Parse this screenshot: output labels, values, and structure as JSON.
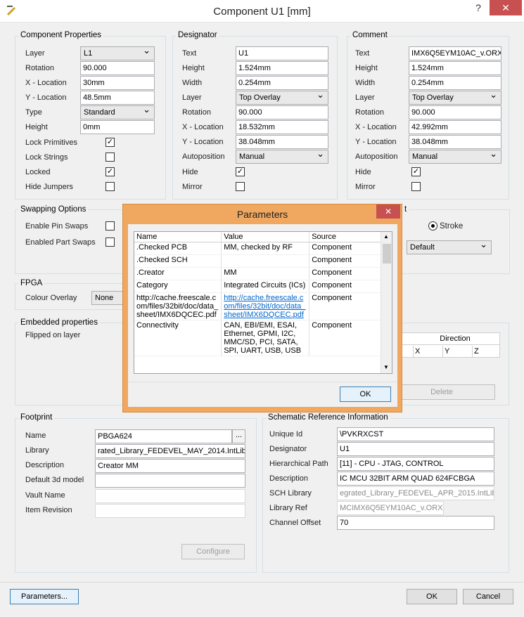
{
  "window": {
    "title": "Component U1 [mm]",
    "help": "?",
    "close": "✕"
  },
  "component_properties": {
    "title": "Component Properties",
    "layer_label": "Layer",
    "layer_value": "L1",
    "rotation_label": "Rotation",
    "rotation_value": "90.000",
    "x_label": "X - Location",
    "x_value": "30mm",
    "y_label": "Y - Location",
    "y_value": "48.5mm",
    "type_label": "Type",
    "type_value": "Standard",
    "height_label": "Height",
    "height_value": "0mm",
    "lock_primitives_label": "Lock Primitives",
    "lock_primitives_checked": true,
    "lock_strings_label": "Lock Strings",
    "lock_strings_checked": false,
    "locked_label": "Locked",
    "locked_checked": true,
    "hide_jumpers_label": "Hide Jumpers",
    "hide_jumpers_checked": false
  },
  "designator": {
    "title": "Designator",
    "text_label": "Text",
    "text_value": "U1",
    "height_label": "Height",
    "height_value": "1.524mm",
    "width_label": "Width",
    "width_value": "0.254mm",
    "layer_label": "Layer",
    "layer_value": "Top Overlay",
    "rotation_label": "Rotation",
    "rotation_value": "90.000",
    "x_label": "X - Location",
    "x_value": "18.532mm",
    "y_label": "Y - Location",
    "y_value": "38.048mm",
    "autopos_label": "Autoposition",
    "autopos_value": "Manual",
    "hide_label": "Hide",
    "hide_checked": true,
    "mirror_label": "Mirror",
    "mirror_checked": false
  },
  "comment": {
    "title": "Comment",
    "text_label": "Text",
    "text_value": "IMX6Q5EYM10AC_v.ORX",
    "height_label": "Height",
    "height_value": "1.524mm",
    "width_label": "Width",
    "width_value": "0.254mm",
    "layer_label": "Layer",
    "layer_value": "Top Overlay",
    "rotation_label": "Rotation",
    "rotation_value": "90.000",
    "x_label": "X - Location",
    "x_value": "42.992mm",
    "y_label": "Y - Location",
    "y_value": "38.048mm",
    "autopos_label": "Autoposition",
    "autopos_value": "Manual",
    "hide_label": "Hide",
    "hide_checked": true,
    "mirror_label": "Mirror",
    "mirror_checked": false
  },
  "swapping": {
    "title": "Swapping Options",
    "pin_swaps_label": "Enable Pin Swaps",
    "pin_swaps_checked": false,
    "part_swaps_label": "Enabled Part Swaps",
    "part_swaps_checked": false
  },
  "stroke": {
    "partial_title": "t",
    "stroke_label": "Stroke",
    "font_value": "Default"
  },
  "fpga": {
    "title": "FPGA",
    "colour_overlay_label": "Colour Overlay",
    "colour_overlay_value": "None"
  },
  "embedded": {
    "title": "Embedded properties",
    "flipped_label": "Flipped on layer",
    "direction_header": "Direction",
    "col_x": "X",
    "col_y": "Y",
    "col_z": "Z",
    "delete_label": "Delete"
  },
  "footprint": {
    "title": "Footprint",
    "name_label": "Name",
    "name_value": "PBGA624",
    "browse_label": "...",
    "library_label": "Library",
    "library_value": "rated_Library_FEDEVEL_MAY_2014.IntLib",
    "description_label": "Description",
    "description_value": "Creator MM",
    "default3d_label": "Default 3d model",
    "default3d_value": "",
    "vault_label": "Vault Name",
    "vault_value": "",
    "item_rev_label": "Item Revision",
    "item_rev_value": "",
    "configure_label": "Configure"
  },
  "schematic": {
    "title": "Schematic Reference Information",
    "unique_id_label": "Unique Id",
    "unique_id_value": "\\PVKRXCST",
    "designator_label": "Designator",
    "designator_value": "U1",
    "hier_label": "Hierarchical Path",
    "hier_value": "[11] - CPU - JTAG, CONTROL",
    "desc_label": "Description",
    "desc_value": "IC MCU 32BIT ARM QUAD 624FCBGA",
    "sch_lib_label": "SCH Library",
    "sch_lib_value": "egrated_Library_FEDEVEL_APR_2015.IntLib",
    "lib_ref_label": "Library Ref",
    "lib_ref_value": "MCIMX6Q5EYM10AC_v.ORX",
    "channel_label": "Channel Offset",
    "channel_value": "70"
  },
  "bottom": {
    "parameters_label": "Parameters...",
    "ok_label": "OK",
    "cancel_label": "Cancel"
  },
  "parameters_dialog": {
    "title": "Parameters",
    "close": "✕",
    "headers": {
      "name": "Name",
      "value": "Value",
      "source": "Source"
    },
    "rows": [
      {
        "name": ".Checked PCB",
        "value": "MM, checked by RF",
        "source": "Component"
      },
      {
        "name": ".Checked SCH",
        "value": "",
        "source": "Component"
      },
      {
        "name": ".Creator",
        "value": "MM",
        "source": "Component"
      },
      {
        "name": "Category",
        "value": "Integrated Circuits (ICs)",
        "source": "Component"
      },
      {
        "name": "http://cache.freescale.com/files/32bit/doc/data_sheet/IMX6DQCEC.pdf",
        "value": "http://cache.freescale.com/files/32bit/doc/data_sheet/IMX6DQCEC.pdf",
        "source": "Component"
      },
      {
        "name": "Connectivity",
        "value": "CAN, EBI/EMI, ESAI, Ethernet, GPMI, I2C, MMC/SD, PCI, SATA, SPI, UART, USB, USB",
        "source": "Component"
      }
    ],
    "ok_label": "OK"
  }
}
